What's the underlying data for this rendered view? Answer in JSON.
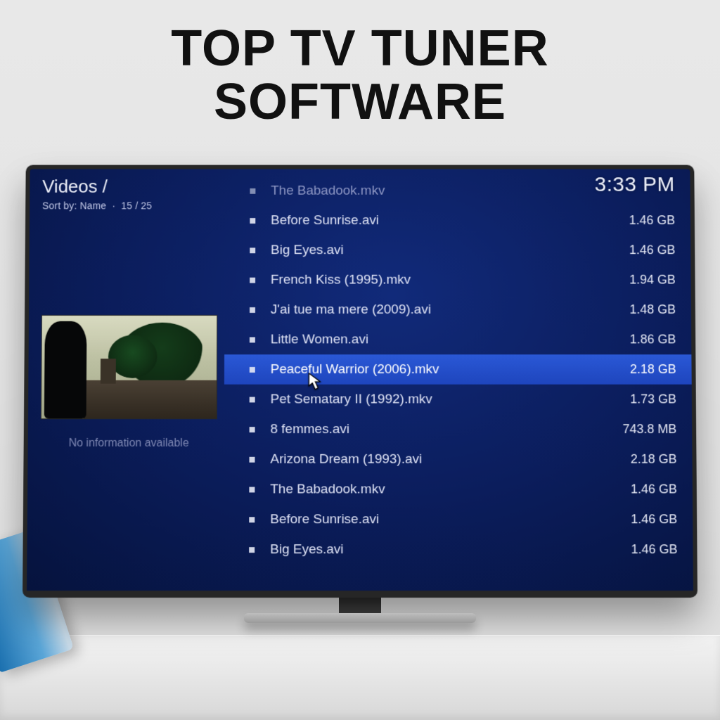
{
  "headline": {
    "line1": "TOP TV TUNER",
    "line2": "SOFTWARE"
  },
  "breadcrumb": "Videos /",
  "sort": {
    "label": "Sort by: Name",
    "sep": "·",
    "position": "15 / 25"
  },
  "clock": "3:33 PM",
  "preview": {
    "noinfo": "No information available"
  },
  "files": [
    {
      "name": "The Babadook.mkv",
      "size": ""
    },
    {
      "name": "Before Sunrise.avi",
      "size": "1.46 GB"
    },
    {
      "name": "Big Eyes.avi",
      "size": "1.46 GB"
    },
    {
      "name": "French Kiss (1995).mkv",
      "size": "1.94 GB"
    },
    {
      "name": "J'ai tue ma mere (2009).avi",
      "size": "1.48 GB"
    },
    {
      "name": "Little Women.avi",
      "size": "1.86 GB"
    },
    {
      "name": "Peaceful Warrior (2006).mkv",
      "size": "2.18 GB"
    },
    {
      "name": "Pet Sematary II (1992).mkv",
      "size": "1.73 GB"
    },
    {
      "name": "8 femmes.avi",
      "size": "743.8 MB"
    },
    {
      "name": "Arizona Dream (1993).avi",
      "size": "2.18 GB"
    },
    {
      "name": "The Babadook.mkv",
      "size": "1.46 GB"
    },
    {
      "name": "Before Sunrise.avi",
      "size": "1.46 GB"
    },
    {
      "name": "Big Eyes.avi",
      "size": "1.46 GB"
    }
  ],
  "selected_index": 6,
  "dim_first": true
}
